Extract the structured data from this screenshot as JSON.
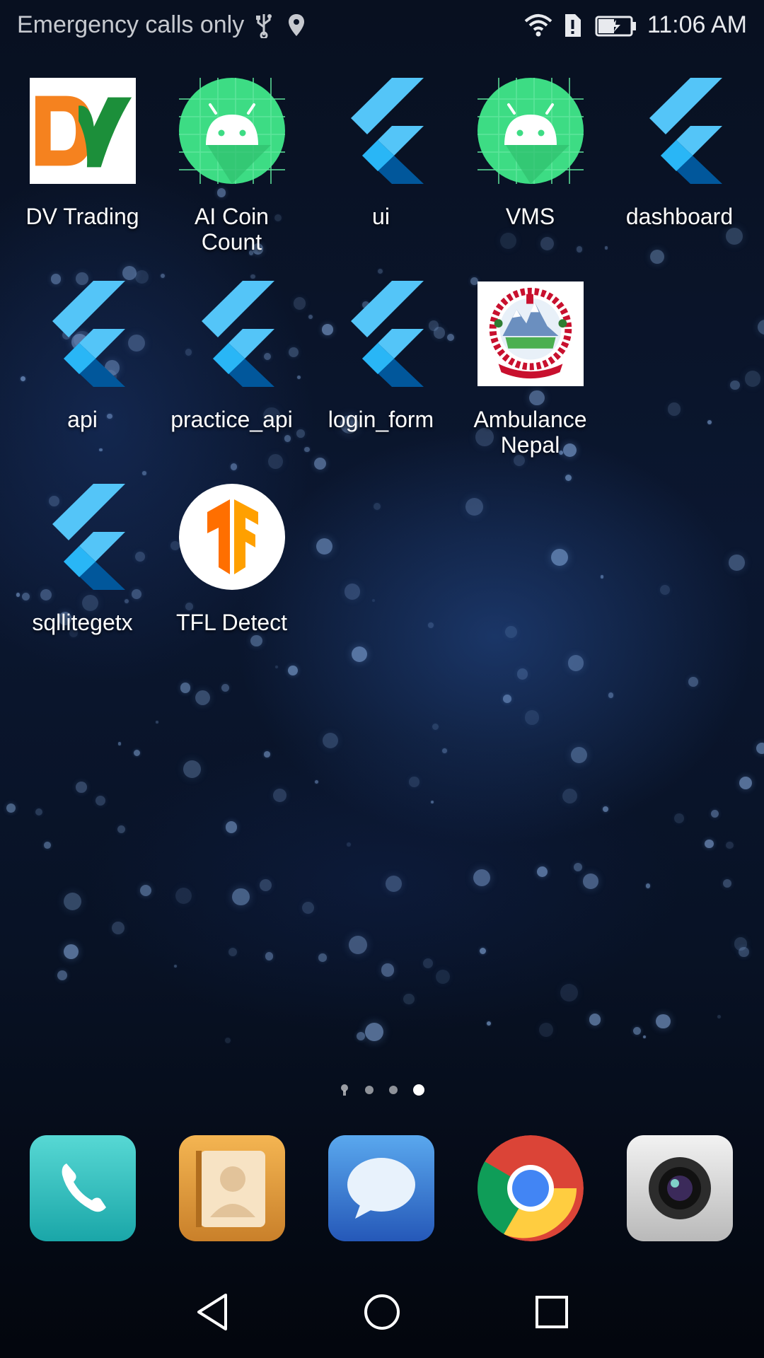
{
  "status_bar": {
    "carrier_text": "Emergency calls only",
    "time": "11:06 AM",
    "icons": [
      "usb-icon",
      "location-icon",
      "wifi-icon",
      "alert-icon",
      "battery-charging-icon"
    ]
  },
  "apps": [
    {
      "label": "DV Trading",
      "icon": "dv-trading-icon"
    },
    {
      "label": "AI Coin\nCount",
      "icon": "android-icon"
    },
    {
      "label": "ui",
      "icon": "flutter-icon"
    },
    {
      "label": "VMS",
      "icon": "android-icon"
    },
    {
      "label": "dashboard",
      "icon": "flutter-icon"
    },
    {
      "label": "api",
      "icon": "flutter-icon"
    },
    {
      "label": "practice_api",
      "icon": "flutter-icon"
    },
    {
      "label": "login_form",
      "icon": "flutter-icon"
    },
    {
      "label": "Ambulance\nNepal",
      "icon": "nepal-emblem-icon"
    },
    {
      "label": "sqllitegetx",
      "icon": "flutter-icon"
    },
    {
      "label": "TFL Detect",
      "icon": "tensorflow-icon"
    }
  ],
  "page_indicator": {
    "pages": 4,
    "active_page": 4
  },
  "dock": [
    "phone-icon",
    "contacts-icon",
    "messages-icon",
    "chrome-icon",
    "camera-icon"
  ],
  "navigation": [
    "back-button",
    "home-button",
    "recents-button"
  ],
  "colors": {
    "android_green": "#3ddc84",
    "flutter_light": "#54c5f8",
    "flutter_dark": "#01579b",
    "tf_orange": "#ff8f00"
  }
}
